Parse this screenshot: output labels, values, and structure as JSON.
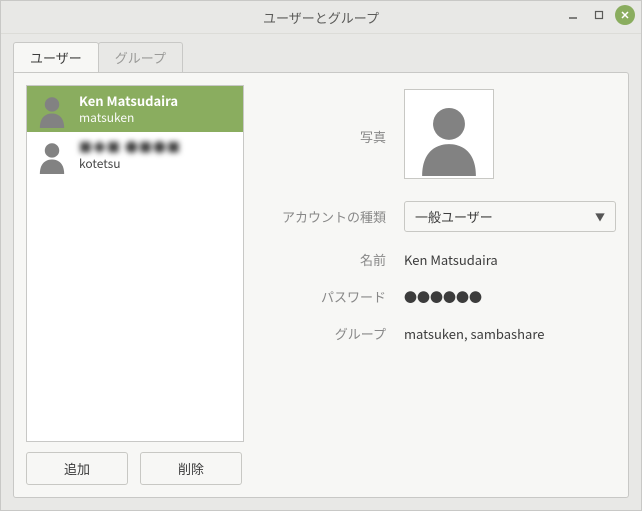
{
  "window": {
    "title": "ユーザーとグループ"
  },
  "tabs": {
    "users": "ユーザー",
    "groups": "グループ"
  },
  "userlist": [
    {
      "fullname": "Ken Matsudaira",
      "username": "matsuken",
      "selected": true
    },
    {
      "fullname": "■◆■ ●■●■",
      "username": "kotetsu",
      "selected": false
    }
  ],
  "buttons": {
    "add": "追加",
    "remove": "削除"
  },
  "detail": {
    "labels": {
      "photo": "写真",
      "account_type": "アカウントの種類",
      "name": "名前",
      "password": "パスワード",
      "groups": "グループ"
    },
    "values": {
      "account_type": "一般ユーザー",
      "name": "Ken Matsudaira",
      "password": "●●●●●●",
      "groups": "matsuken, sambashare"
    }
  }
}
